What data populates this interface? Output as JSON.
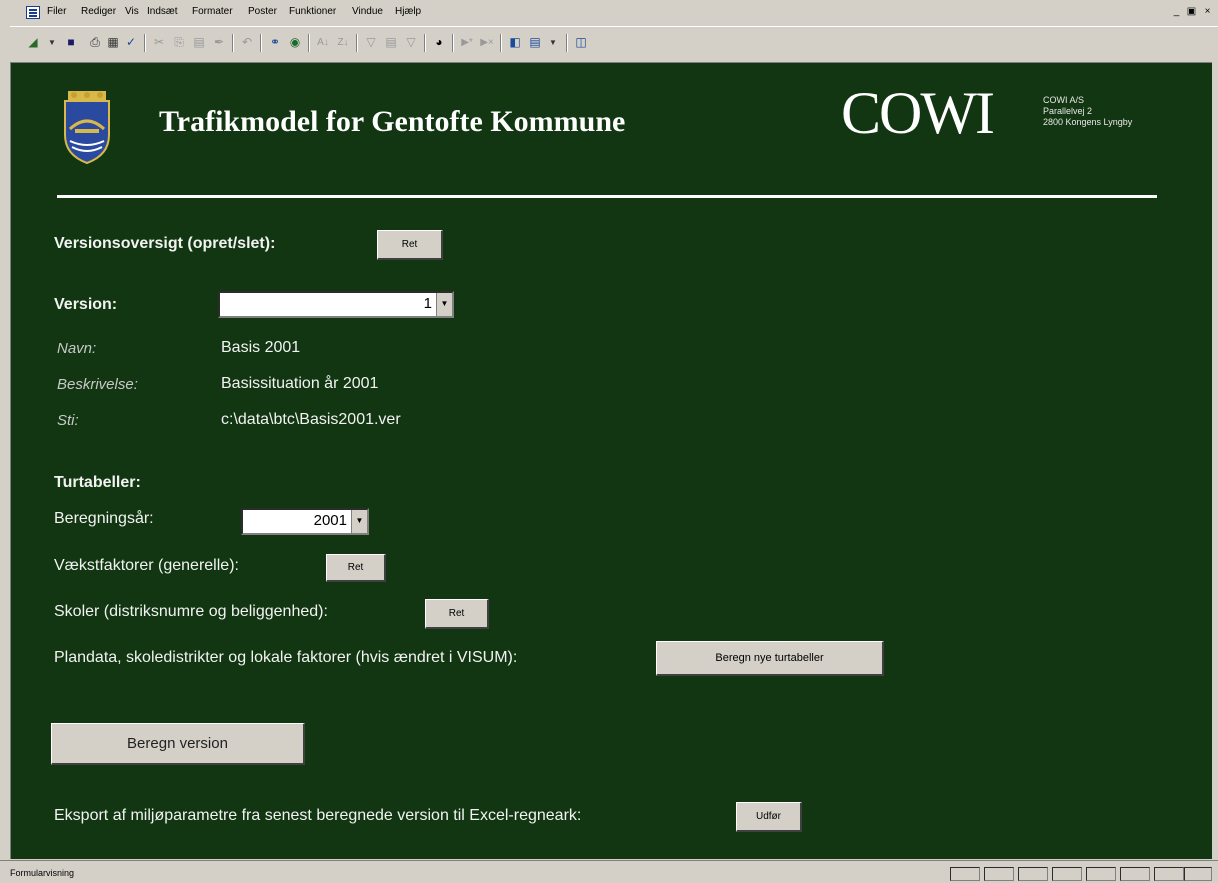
{
  "menu": {
    "items": [
      "Filer",
      "Rediger",
      "Vis",
      "Indsæt",
      "Formater",
      "Poster",
      "Funktioner",
      "Vindue",
      "Hjælp"
    ]
  },
  "toolbar": {
    "icons": [
      "design-view-icon",
      "save-icon",
      "print-icon",
      "print-preview-icon",
      "spelling-icon",
      "cut-icon",
      "copy-icon",
      "paste-icon",
      "format-painter-icon",
      "undo-icon",
      "hyperlink-icon",
      "web-icon",
      "sort-ascending-icon",
      "sort-descending-icon",
      "filter-selection-icon",
      "filter-form-icon",
      "apply-filter-icon",
      "find-icon",
      "new-record-icon",
      "delete-record-icon",
      "database-window-icon",
      "new-object-icon",
      "help-icon"
    ]
  },
  "header": {
    "title": "Trafikmodel for Gentofte Kommune",
    "logo_text": "COWI",
    "address_lines": [
      "COWI A/S",
      "Parallelvej 2",
      "2800 Kongens Lyngby"
    ]
  },
  "versions": {
    "overview_label": "Versionsoversigt (opret/slet):",
    "overview_button": "Ret",
    "version_label": "Version:",
    "version_value": "1",
    "name_label": "Navn:",
    "name_value": "Basis 2001",
    "description_label": "Beskrivelse:",
    "description_value": "Basissituation år 2001",
    "path_label": "Sti:",
    "path_value": "c:\\data\\btc\\Basis2001.ver"
  },
  "trip_tables": {
    "heading": "Turtabeller:",
    "year_label": "Beregningsår:",
    "year_value": "2001",
    "growth_label": "Vækstfaktorer (generelle):",
    "growth_button": "Ret",
    "schools_label": "Skoler (distriksnumre og beliggenhed):",
    "schools_button": "Ret",
    "plandata_label": "Plandata, skoledistrikter og lokale faktorer (hvis ændret i VISUM):",
    "plandata_button": "Beregn nye turtabeller"
  },
  "actions": {
    "compute_button": "Beregn version",
    "export_label": "Eksport af miljøparametre fra senest beregnede version til Excel-regneark:",
    "export_button": "Udfør"
  },
  "statusbar": {
    "text": "Formularvisning"
  },
  "colors": {
    "form_background": "#113611",
    "chrome": "#d4d0c8"
  }
}
